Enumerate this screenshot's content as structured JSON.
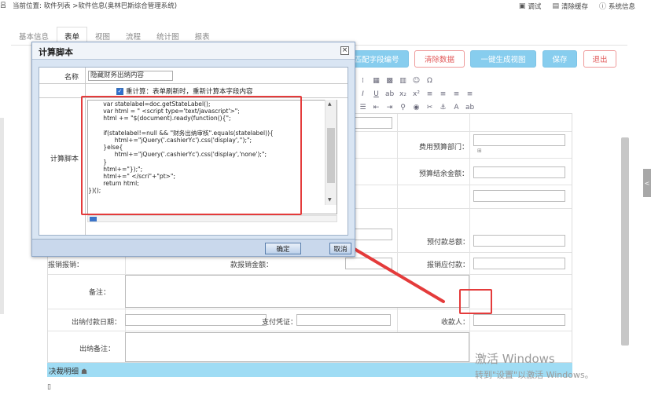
{
  "topbar": {
    "left_edge": "吕",
    "breadcrumb": "当前位置: 软件列表 >软件信息(奥林巴斯综合管理系统)",
    "actions": [
      {
        "icon": "debug-icon",
        "label": "调试"
      },
      {
        "icon": "clear-cache-icon",
        "label": "清除缓存"
      },
      {
        "icon": "info-icon",
        "label": "系统信息"
      }
    ]
  },
  "tabs": [
    "基本信息",
    "表单",
    "视图",
    "流程",
    "统计图",
    "报表"
  ],
  "active_tab": "表单",
  "buttons": {
    "field_no": "匹配字段编号",
    "clear_data": "清除数据",
    "gen_view": "一键生成视图",
    "save": "保存",
    "exit": "退出"
  },
  "form": {
    "label_expense_dept": "费用预算部门：",
    "label_budget_balance": "预算结余金额：",
    "label_prepay_total": "预付款总额：",
    "label_reimburse_payable": "报销应付款：",
    "label_reimburse_amount": "报销报销：",
    "label_amount_left": "款报销金额：",
    "label_remark": "备注：",
    "label_pay_date": "出纳付款日期：",
    "label_pay_voucher": "支付凭证：",
    "label_payee": "收款人：",
    "label_cashier_remark": "出纳备注：",
    "detail_title": "决裁明细"
  },
  "watermark": {
    "line1": "激活 Windows",
    "line2": "转到\"设置\"以激活 Windows。"
  },
  "dialog": {
    "title": "计算脚本",
    "close": "×",
    "name_label": "名称",
    "name_value": "隐藏财务出纳内容",
    "recalc_label": "重计算：表单刷新时，重新计算本字段内容",
    "script_label": "计算脚本",
    "ok": "确定",
    "cancel": "取消",
    "code_lines": [
      "        var statelabel=doc.getStateLabel();",
      "        var html = \" <script type='text/javascript'>\";",
      "        html += \"$(document).ready(function(){\";",
      "",
      "        if(statelabel!=null && \"财务出纳审核\".equals(statelabel)){",
      "              html+=\"jQuery('.cashierYc').css('display','');\";",
      "        }else{",
      "              html+=\"jQuery('.cashierYc').css('display','none');\";",
      "        }",
      "        html+=\"});\";",
      "        html+=\" </scri\"+\"pt>\";",
      "        return html;",
      "})();"
    ]
  },
  "colors": {
    "highlight": "#e43b3b",
    "blue_button": "#87cdee",
    "detail_bar": "#9fdcf4"
  }
}
